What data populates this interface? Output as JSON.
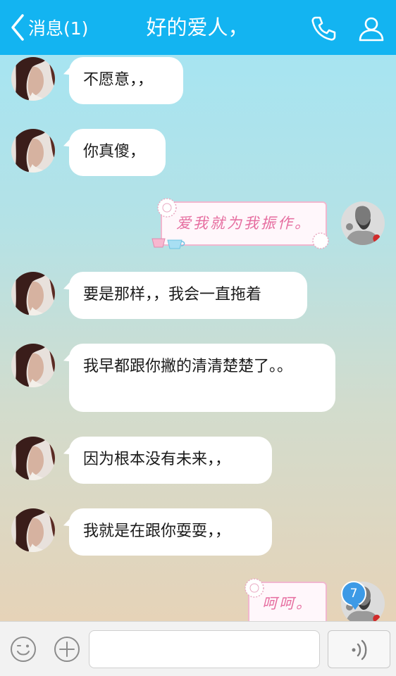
{
  "header": {
    "back_label": "消息(1)",
    "title": "好的爱人，",
    "background": "#13b4f1"
  },
  "messages": [
    {
      "side": "left",
      "type": "text",
      "text": "不愿意，，"
    },
    {
      "side": "left",
      "type": "text",
      "text": "你真傻，"
    },
    {
      "side": "right",
      "type": "sticker",
      "text": "爱我就为我振作。"
    },
    {
      "side": "left",
      "type": "text",
      "text": "要是那样，，我会一直拖着"
    },
    {
      "side": "left",
      "type": "text",
      "text": "我早都跟你撇的清清楚楚了。。"
    },
    {
      "side": "left",
      "type": "text",
      "text": "因为根本没有未来，，"
    },
    {
      "side": "left",
      "type": "text",
      "text": "我就是在跟你耍耍，，"
    },
    {
      "side": "right",
      "type": "sticker",
      "text": "呵呵。"
    }
  ],
  "unread_badge": "7",
  "input": {
    "value": "",
    "placeholder": ""
  },
  "icons": {
    "back": "chevron-left-icon",
    "call": "phone-icon",
    "profile": "user-icon",
    "emoji": "emoji-icon",
    "more": "plus-icon",
    "voice": "voice-icon"
  }
}
